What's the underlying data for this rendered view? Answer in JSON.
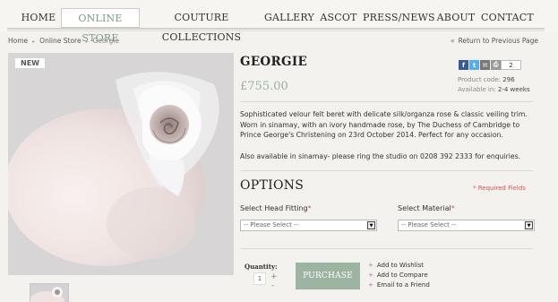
{
  "nav": {
    "items": [
      {
        "label": "HOME"
      },
      {
        "label": "ONLINE STORE"
      },
      {
        "label": "COUTURE COLLECTIONS"
      },
      {
        "label": "GALLERY"
      },
      {
        "label": "ASCOT"
      },
      {
        "label": "PRESS/NEWS"
      },
      {
        "label": "ABOUT"
      },
      {
        "label": "CONTACT"
      }
    ],
    "active_index": 1
  },
  "breadcrumb": {
    "home": "Home",
    "store": "Online Store",
    "current": "Georgie",
    "separator": "▸"
  },
  "return_link": {
    "arrow": "«",
    "label": "Return to Previous Page"
  },
  "product": {
    "badge": "NEW",
    "title": "GEORGIE",
    "price": "£755.00",
    "share_count": "2",
    "product_code_label": "Product code:",
    "product_code": "296",
    "availability_label": "Available in:",
    "availability": "2-4 weeks",
    "description": "Sophisticated velour felt beret with delicate silk/organza rose & classic veiling trim. Worn in sinamay, with an ivory handmade rose, by The Duchess of Cambridge to Prince George's Christening on 23rd October 2014. Perfect for any occasion.",
    "description_2": "Also available in sinamay- please ring the studio on 0208 392 2333 for enquiries."
  },
  "options": {
    "heading": "OPTIONS",
    "required_note": "* Required Fields",
    "head_fitting": {
      "label": "Select Head Fitting",
      "star": "*",
      "value": "-- Please Select --"
    },
    "material": {
      "label": "Select Material",
      "star": "*",
      "value": "-- Please Select --"
    }
  },
  "purchase": {
    "quantity_label": "Quantity:",
    "quantity": "1",
    "plus": "+",
    "minus": "-",
    "button": "PURCHASE",
    "add_wishlist": "Add to Wishlist",
    "add_compare": "Add to Compare",
    "email_friend": "Email to a Friend"
  },
  "colors": {
    "accent_green": "#9db4a3",
    "price_green": "#9cb2a1",
    "required_red": "#d9534f",
    "background": "#f3f2ee"
  }
}
